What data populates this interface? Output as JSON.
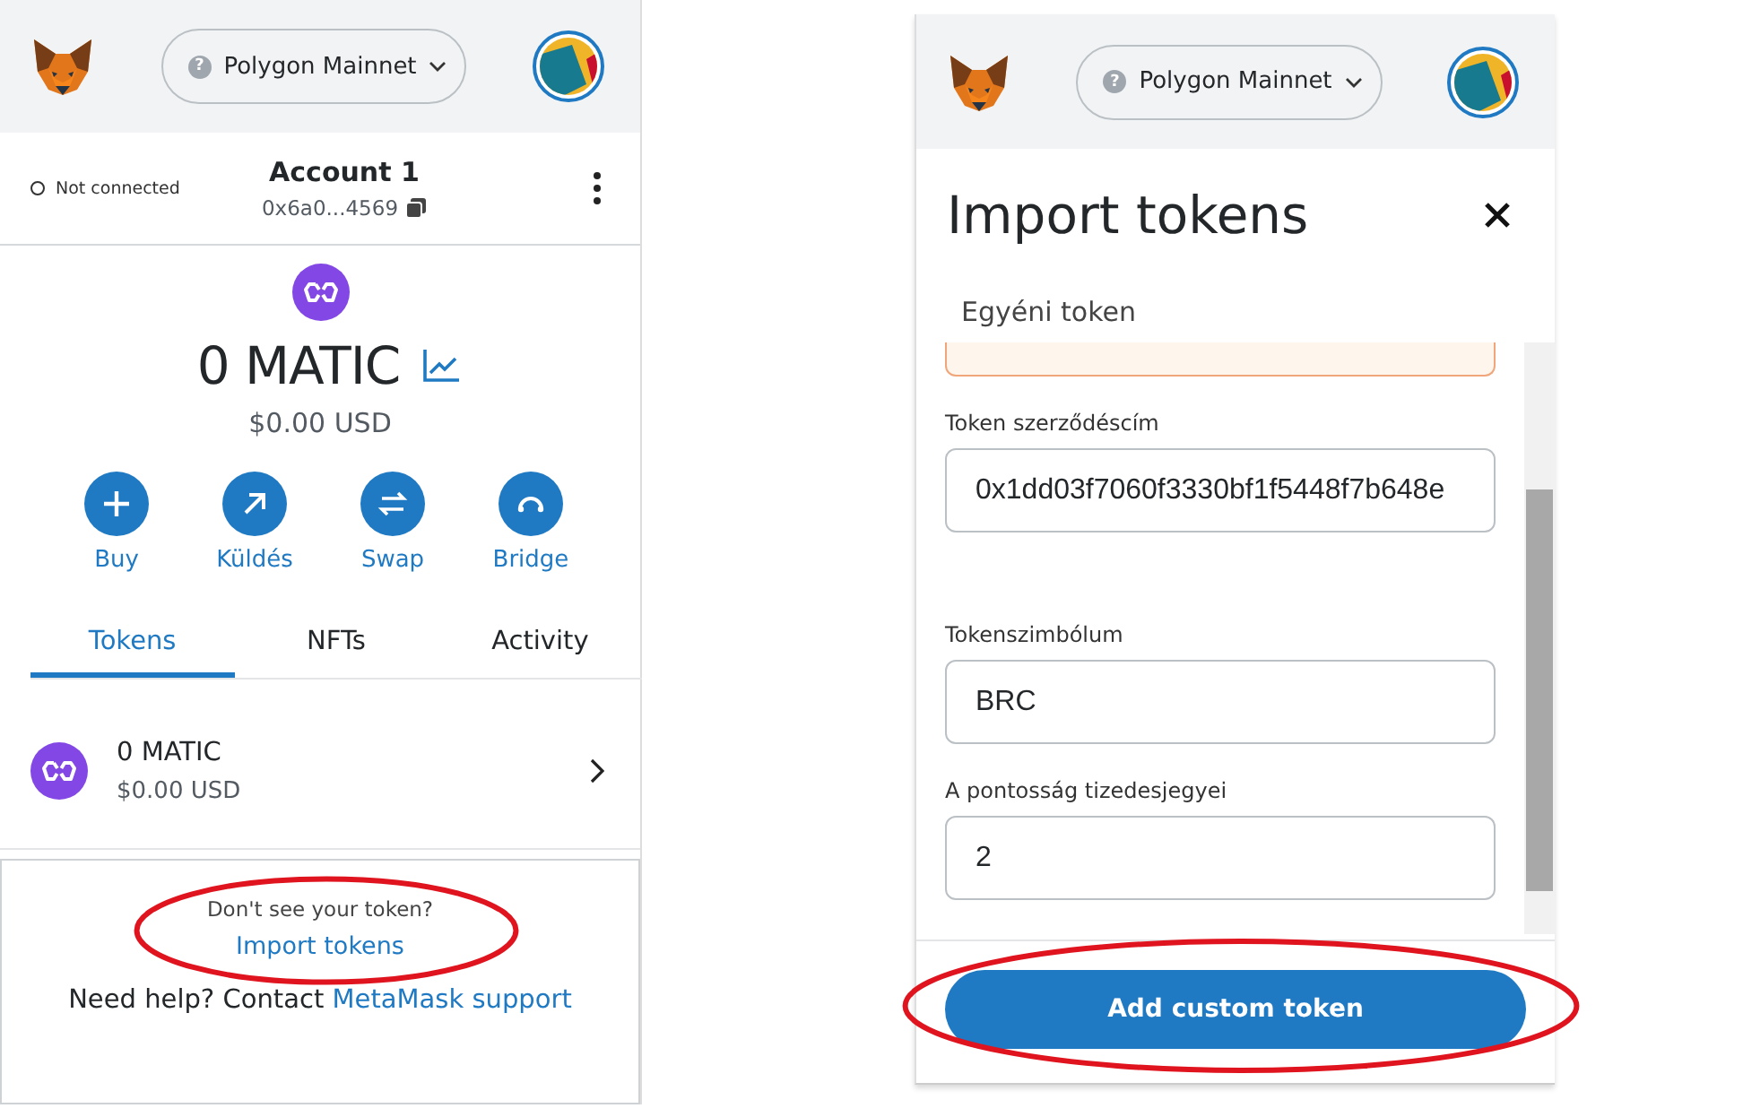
{
  "wallet": {
    "header": {
      "network_badge": "?",
      "network": "Polygon Mainnet"
    },
    "account": {
      "connection": "Not connected",
      "connected": false,
      "name": "Account 1",
      "address": "0x6a0...4569"
    },
    "balance": {
      "amount": "0 MATIC",
      "fiat": "$0.00 USD"
    },
    "actions": [
      {
        "kind": "buy",
        "label": "Buy"
      },
      {
        "kind": "send",
        "label": "Küldés"
      },
      {
        "kind": "swap",
        "label": "Swap"
      },
      {
        "kind": "bridge",
        "label": "Bridge"
      }
    ],
    "tabs": [
      {
        "label": "Tokens",
        "selected": true
      },
      {
        "label": "NFTs",
        "selected": false
      },
      {
        "label": "Activity",
        "selected": false
      }
    ],
    "tokens": [
      {
        "amount": "0 MATIC",
        "fiat": "$0.00 USD"
      }
    ],
    "footer": {
      "prompt": "Don't see your token?",
      "import_link": "Import tokens",
      "highlighted": true,
      "help_text": "Need help? Contact",
      "support_link": "MetaMask support"
    }
  },
  "import": {
    "header": {
      "network_badge": "?",
      "network": "Polygon Mainnet"
    },
    "title": "Import tokens",
    "section": "Egyéni token",
    "fields": [
      {
        "label": "Token szerződéscím",
        "value": "0x1dd03f7060f3330bf1f5448f7b648e"
      },
      {
        "label": "Tokenszimbólum",
        "value": "BRC"
      },
      {
        "label": "A pontosság tizedesjegyei",
        "value": "2"
      }
    ],
    "submit": {
      "label": "Add custom token",
      "highlighted": true
    }
  }
}
